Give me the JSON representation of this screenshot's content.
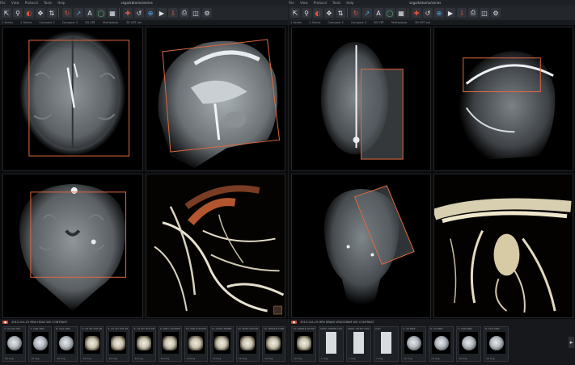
{
  "left_screen": {
    "menu": [
      "File",
      "View",
      "Protocol",
      "Tools",
      "Help"
    ],
    "window_title": "sega/kbtomo/series",
    "tabs": [
      "1 Series",
      "2 Series",
      "Compare 2",
      "Compare 3",
      "3D VRT",
      "Multiplanar",
      "3D VRT set"
    ],
    "strip_header": "2015-Oct-15  MRA HEAD WO CONTRAST",
    "thumbnails": [
      {
        "label": "2: AX 3D TOF",
        "count": "19 Img",
        "kind": "brain"
      },
      {
        "label": "7: COR MRA",
        "count": "19 Img",
        "kind": "brain"
      },
      {
        "label": "8: SAG MRA",
        "count": "19 Img",
        "kind": "brain"
      },
      {
        "label": "3: AX 3D TOF_MIP_C",
        "count": "19 Img",
        "kind": "vessel"
      },
      {
        "label": "3: AX 3D TOF_MIP_C",
        "count": "19 Img",
        "kind": "vessel"
      },
      {
        "label": "4: AX 3D TOF_MIP_S",
        "count": "19 Img",
        "kind": "vessel"
      },
      {
        "label": "9: ANT L ROTATE",
        "count": "19 Img",
        "kind": "vessel"
      },
      {
        "label": "10: ANT R ROTATE",
        "count": "19 Img",
        "kind": "vessel"
      },
      {
        "label": "11: POST TUMBLE",
        "count": "19 Img",
        "kind": "vessel"
      },
      {
        "label": "12: POST ROTATE",
        "count": "19 Img",
        "kind": "vessel"
      },
      {
        "label": "13: WHOLE TUMBLE",
        "count": "19 Img",
        "kind": "vessel"
      }
    ]
  },
  "right_screen": {
    "menu": [
      "File",
      "View",
      "Protocol",
      "Tools",
      "Help"
    ],
    "window_title": "sega/kbtomo/series",
    "tabs": [
      "1 Series",
      "2 Series",
      "Compare 2",
      "Compare 3",
      "3D VRT",
      "Multiplanar",
      "3D VRT set"
    ],
    "strip_header": "2015-Oct-15  MRV BRAIN VENOGRAM WO CONTRAST",
    "thumbnails": [
      {
        "label": "14: WHOLE ROTATE",
        "count": "19 Img",
        "kind": "vessel"
      },
      {
        "label": "9999: ORDER DOCS",
        "count": "1 Img",
        "kind": "doc"
      },
      {
        "label": "9999: STUDY DOCS",
        "count": "1 Img",
        "kind": "doc"
      },
      {
        "label": "CAD",
        "count": "1 Img",
        "kind": "doc"
      },
      {
        "label": "2: AX MRV",
        "count": "19 Img",
        "kind": "brain"
      },
      {
        "label": "6: AX MRV",
        "count": "19 Img",
        "kind": "brain"
      },
      {
        "label": "7: COR MRV",
        "count": "19 Img",
        "kind": "brain"
      },
      {
        "label": "8: SAG MRV",
        "count": "19 Img",
        "kind": "brain"
      }
    ]
  }
}
